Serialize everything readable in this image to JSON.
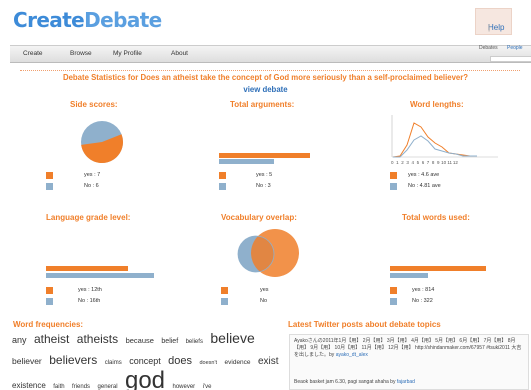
{
  "header": {
    "logo_part1": "Create",
    "logo_part2": "Debate",
    "help_label": "Help",
    "help_sep": "|"
  },
  "nav": {
    "items": [
      "Create",
      "Browse",
      "My Profile",
      "About"
    ],
    "search_tabs": [
      "Debates",
      "People"
    ]
  },
  "stats": {
    "title": "Debate Statistics for Does an atheist take the concept of God more seriously than a self-proclaimed believer?",
    "view_link": "view debate"
  },
  "side_scores": {
    "title": "Side scores:",
    "yes_label": "yes : 7",
    "no_label": "No : 6",
    "values": {
      "yes": 7,
      "no": 6
    }
  },
  "total_arguments": {
    "title": "Total arguments:",
    "yes_label": "yes : 5",
    "no_label": "No : 3",
    "values": {
      "yes": 5,
      "no": 3
    }
  },
  "word_lengths": {
    "title": "Word lengths:",
    "yes_label": "yes : 4.6 ave",
    "no_label": "No : 4.81 ave",
    "x_ticks": [
      "0",
      "1",
      "2",
      "3",
      "4",
      "5",
      "6",
      "7",
      "8",
      "9",
      "10",
      "11",
      "12"
    ]
  },
  "language_grade": {
    "title": "Language grade level:",
    "yes_label": "yes : 12th",
    "no_label": "No : 16th",
    "values": {
      "yes": 12,
      "no": 16
    }
  },
  "vocab_overlap": {
    "title": "Vocabulary overlap:",
    "yes_label": "yes",
    "no_label": "No"
  },
  "total_words": {
    "title": "Total words used:",
    "yes_label": "yes : 814",
    "no_label": "No : 322",
    "values": {
      "yes": 814,
      "no": 322
    }
  },
  "word_freq": {
    "title": "Word frequencies:",
    "words": [
      {
        "text": "any",
        "size": 9
      },
      {
        "text": "atheist",
        "size": 12
      },
      {
        "text": "atheists",
        "size": 12
      },
      {
        "text": "because",
        "size": 7.5
      },
      {
        "text": "belief",
        "size": 7
      },
      {
        "text": "beliefs",
        "size": 6
      },
      {
        "text": "believe",
        "size": 14
      },
      {
        "text": "believer",
        "size": 8.5
      },
      {
        "text": "believers",
        "size": 12
      },
      {
        "text": "claims",
        "size": 6
      },
      {
        "text": "concept",
        "size": 9
      },
      {
        "text": "does",
        "size": 11
      },
      {
        "text": "doesn't",
        "size": 5.5
      },
      {
        "text": "evidence",
        "size": 6.5
      },
      {
        "text": "exist",
        "size": 10
      },
      {
        "text": "existence",
        "size": 8
      },
      {
        "text": "faith",
        "size": 6
      },
      {
        "text": "friends",
        "size": 6
      },
      {
        "text": "general",
        "size": 6
      },
      {
        "text": "god",
        "size": 24
      },
      {
        "text": "however",
        "size": 6
      },
      {
        "text": "i've",
        "size": 6
      }
    ]
  },
  "twitter": {
    "title": "Latest Twitter posts about debate topics",
    "tweet1_text": "Ayakoさんの2011年1月【用】 2月【用】 3月【用】 4月【用】 5月【用】 6月【用】 7月【用】 8月【用】 9月【用】 10月【用】 11月【用】 12月【用】 http://shindanmaker.com/67957 #tsuki2011 大吉を出しました。by",
    "tweet1_user": "ayako_dt_alex",
    "tweet2_text": "Beaok basket jam 6.30, pagi sangat ahaha by",
    "tweet2_user": "fajarbad"
  },
  "colors": {
    "yes": "#f07f2a",
    "no": "#8fb0cc",
    "link": "#2e6fb8"
  }
}
